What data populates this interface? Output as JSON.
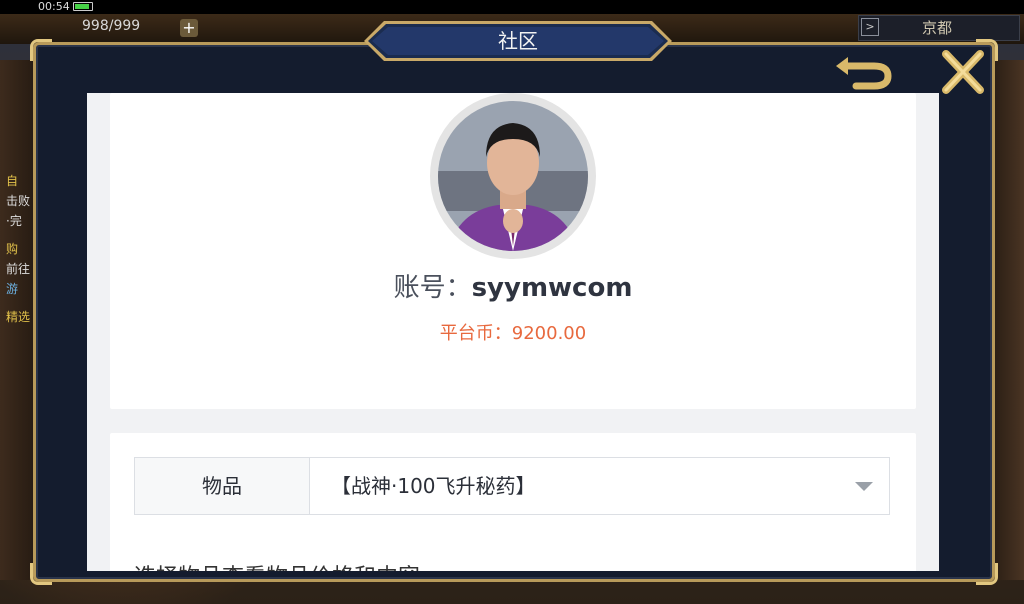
{
  "status_bar": {
    "time": "00:54"
  },
  "hud": {
    "energy": "998/999",
    "plus_label": "+",
    "city_arrow": ">",
    "city": "京都",
    "left_texts": [
      "自",
      "击败",
      "·完",
      "购",
      "前往",
      "游",
      "精选"
    ]
  },
  "modal": {
    "title": "社区",
    "back_icon": "back-arrow-icon",
    "close_icon": "close-x-icon"
  },
  "profile": {
    "account_label": "账号：",
    "account_value": "syymwcom",
    "coin_label": "平台币：",
    "coin_value": "9200.00"
  },
  "item_select": {
    "label": "物品",
    "selected": "【战神·100飞升秘药】"
  },
  "hint": "选择物品查看物品价格和内容",
  "colors": {
    "accent_orange": "#e8693e",
    "frame_gold": "#b89a5a",
    "frame_navy": "#141c2e"
  }
}
